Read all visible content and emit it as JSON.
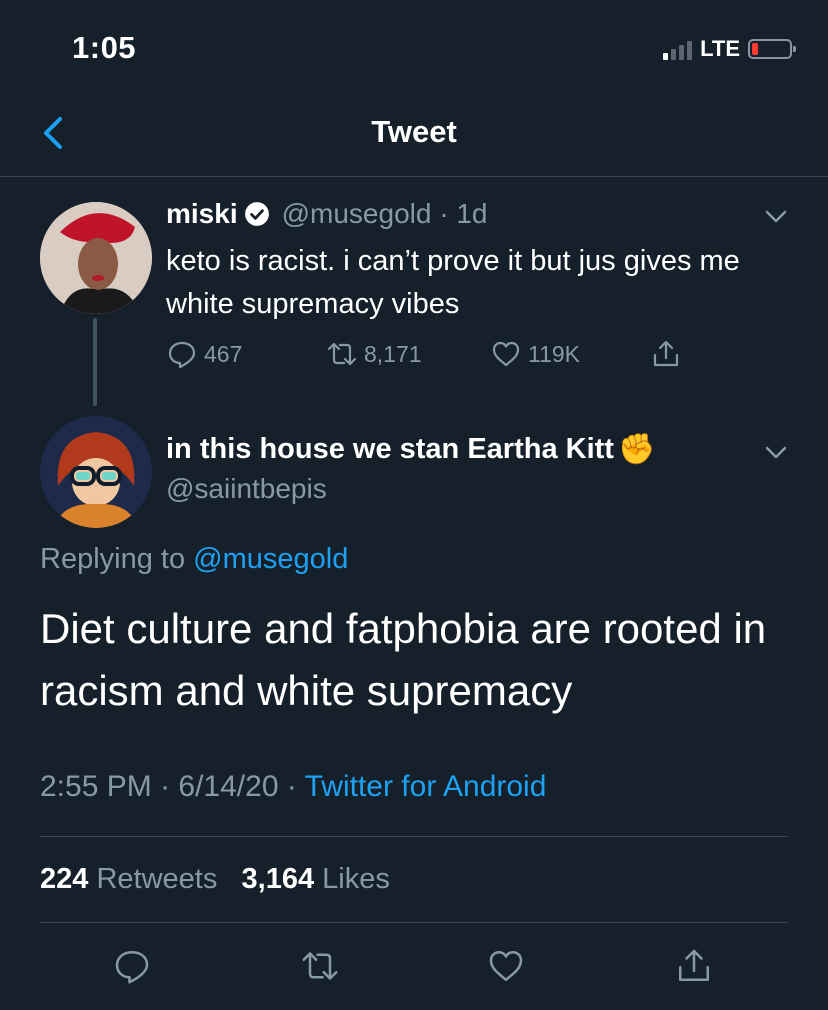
{
  "status_bar": {
    "time": "1:05",
    "network": "LTE"
  },
  "header": {
    "title": "Tweet"
  },
  "parent_tweet": {
    "name": "miski",
    "handle": "@musegold",
    "age": "1d",
    "text": "keto is racist. i can’t prove it but jus gives me white supremacy vibes",
    "replies": "467",
    "retweets": "8,171",
    "likes": "119K"
  },
  "main_tweet": {
    "name": "in this house we stan Eartha Kitt",
    "name_emoji": "✊",
    "handle": "@saiintbepis",
    "replying_prefix": "Replying to",
    "replying_to": "@musegold",
    "text": "Diet culture and fatphobia are rooted in racism and white supremacy",
    "time": "2:55 PM",
    "date": "6/14/20",
    "source": "Twitter for Android",
    "retweet_count": "224",
    "retweet_label": "Retweets",
    "like_count": "3,164",
    "like_label": "Likes"
  },
  "colors": {
    "background": "#15202b",
    "accent": "#1da1f2",
    "muted": "#8899a6",
    "divider": "#38444d"
  }
}
